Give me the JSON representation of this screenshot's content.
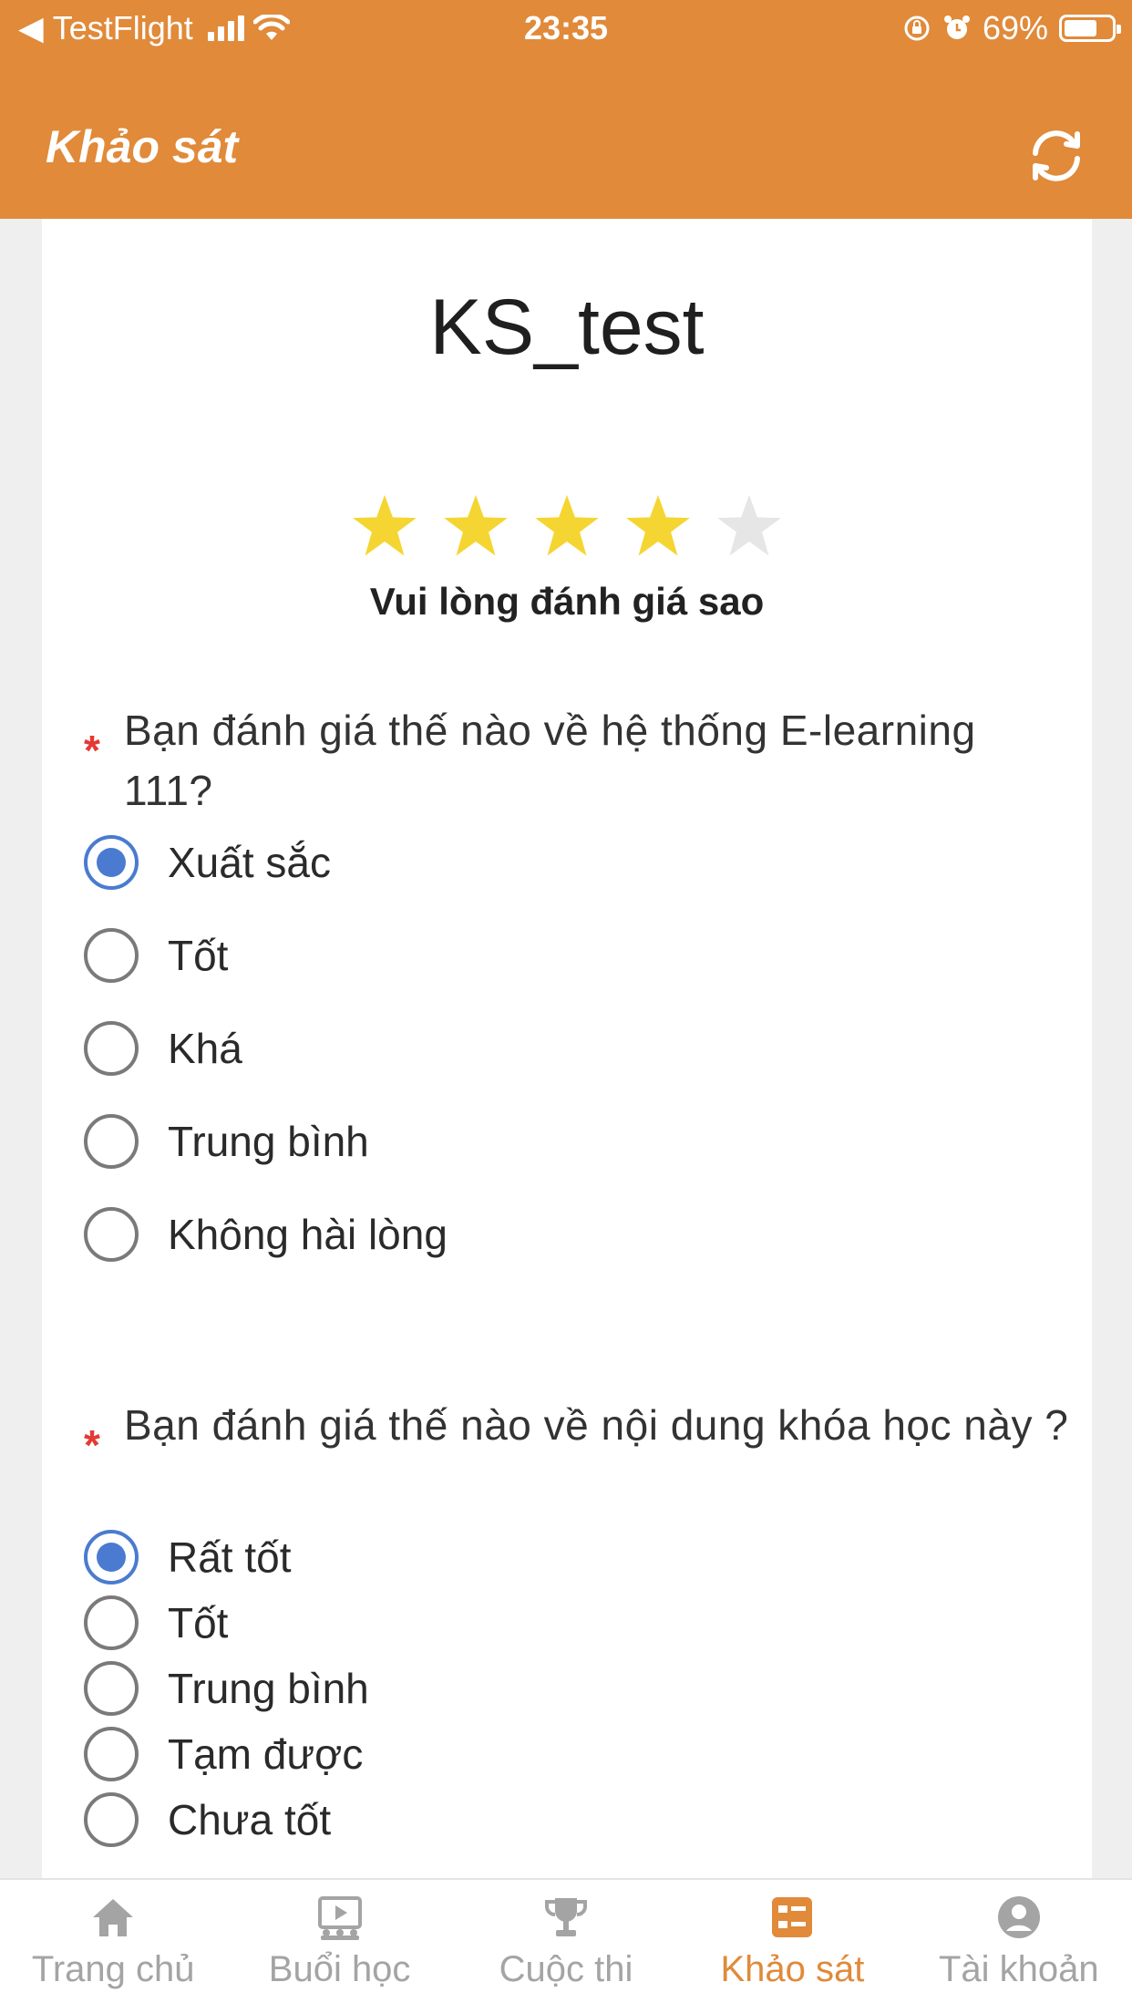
{
  "status_bar": {
    "back_app": "TestFlight",
    "time": "23:35",
    "battery": "69%"
  },
  "header": {
    "title": "Khảo sát",
    "refresh_icon": "refresh-icon"
  },
  "survey": {
    "title": "KS_test",
    "rating": {
      "value": 4,
      "max": 5,
      "hint": "Vui lòng đánh giá sao"
    },
    "questions": [
      {
        "required_mark": "*",
        "text": "Bạn đánh giá thế nào về hệ thống E-learning 111?",
        "options": [
          "Xuất sắc",
          "Tốt",
          "Khá",
          "Trung bình",
          "Không hài lòng"
        ],
        "selected": "Xuất sắc"
      },
      {
        "required_mark": "*",
        "text": "Bạn đánh giá thế nào về nội dung khóa học này ?",
        "options": [
          "Rất tốt",
          "Tốt",
          "Trung bình",
          "Tạm được",
          "Chưa tốt"
        ],
        "selected": "Rất tốt"
      }
    ]
  },
  "tabs": [
    {
      "label": "Trang chủ",
      "icon": "home-icon"
    },
    {
      "label": "Buổi học",
      "icon": "video-lesson-icon"
    },
    {
      "label": "Cuộc thi",
      "icon": "trophy-icon"
    },
    {
      "label": "Khảo sát",
      "icon": "survey-list-icon",
      "active": true
    },
    {
      "label": "Tài khoản",
      "icon": "account-icon"
    }
  ],
  "colors": {
    "accent": "#e08a3a",
    "star_filled": "#f5d531",
    "star_empty": "#e6e6e6",
    "radio_selected": "#4a7bd0",
    "required": "#e53935"
  }
}
